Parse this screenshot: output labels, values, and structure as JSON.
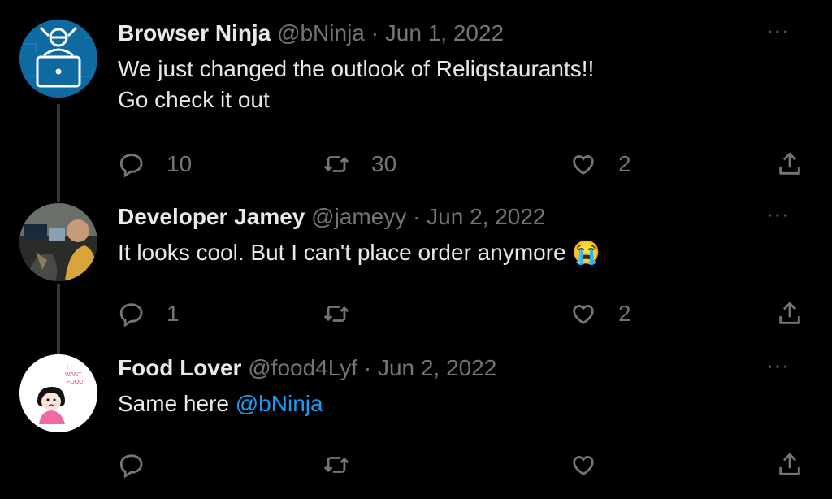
{
  "tweets": [
    {
      "name": "Browser Ninja",
      "handle": "@bNinja",
      "separator": "·",
      "date": "Jun 1, 2022",
      "text": "We just changed the outlook of Reliqstaurants!!\n Go check it out",
      "replies": "10",
      "retweets": "30",
      "likes": "2"
    },
    {
      "name": "Developer Jamey",
      "handle": "@jameyy",
      "separator": "·",
      "date": "Jun 2, 2022",
      "text": "It looks cool. But I can't place order anymore",
      "emoji": "😭",
      "replies": "1",
      "retweets": "",
      "likes": "2"
    },
    {
      "name": "Food Lover",
      "handle": "@food4Lyf",
      "separator": "·",
      "date": "Jun 2, 2022",
      "text": "Same here ",
      "mention": "@bNinja",
      "replies": "",
      "retweets": "",
      "likes": ""
    }
  ],
  "avatar_text": {
    "want_food": "I WANT FOOD"
  },
  "more_label": "···",
  "icons": {
    "reply": "reply-icon",
    "retweet": "retweet-icon",
    "like": "like-icon",
    "share": "share-icon"
  },
  "colors": {
    "background": "#000000",
    "text": "#e7e9ea",
    "muted": "#71767b",
    "link": "#1d9bf0"
  }
}
